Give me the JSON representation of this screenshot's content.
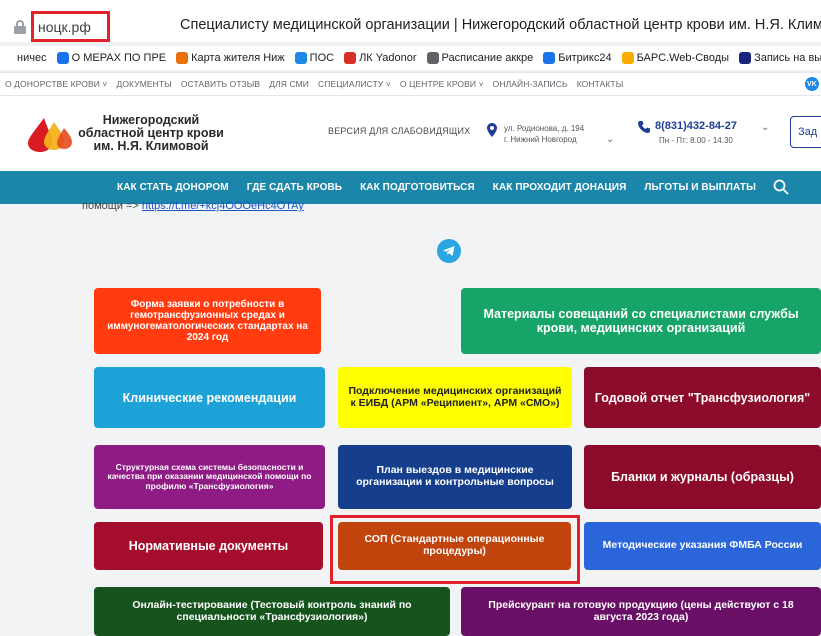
{
  "browser": {
    "url": "ноцк.рф",
    "title": "Специалисту медицинской организации | Нижегородский областной центр крови им. Н.Я. Климовой",
    "bookmarks": [
      {
        "label": "ничес",
        "icon": "blank-icon",
        "color": "#ffffff"
      },
      {
        "label": "О МЕРАХ ПО ПРЕ",
        "icon": "check-circle-icon",
        "color": "#1a73e8"
      },
      {
        "label": "Карта жителя Ниж",
        "icon": "deer-icon",
        "color": "#e8710a"
      },
      {
        "label": "ПОС",
        "icon": "gosuslugi-icon",
        "color": "#1e88e5"
      },
      {
        "label": "ЛК Yadonor",
        "icon": "blood-drop-icon",
        "color": "#d93025"
      },
      {
        "label": "Расписание аккре",
        "icon": "rings-icon",
        "color": "#5f6368"
      },
      {
        "label": "Битрикс24",
        "icon": "bitrix-icon",
        "color": "#1a73e8"
      },
      {
        "label": "БАРС.Web-Своды",
        "icon": "bars-icon",
        "color": "#f9ab00"
      },
      {
        "label": "Запись на выезд",
        "icon": "car-icon",
        "color": "#1a237e"
      }
    ]
  },
  "topnav": {
    "items": [
      "О ДОНОРСТВЕ КРОВИ",
      "ДОКУМЕНТЫ",
      "ОСТАВИТЬ ОТЗЫВ",
      "ДЛЯ СМИ",
      "СПЕЦИАЛИСТУ",
      "О ЦЕНТРЕ КРОВИ",
      "ОНЛАЙН-ЗАПИСЬ",
      "КОНТАКТЫ"
    ],
    "dropdown_flags": [
      true,
      false,
      false,
      false,
      true,
      true,
      false,
      false
    ],
    "vk": "VK"
  },
  "header": {
    "org_line1": "Нижегородский",
    "org_line2": "областной центр крови",
    "org_line3": "им. Н.Я. Климовой",
    "low_vision": "ВЕРСИЯ ДЛЯ СЛАБОВИДЯЩИХ",
    "address_line1": "ул. Родионова, д. 194",
    "address_line2": "г. Нижний Новгород",
    "phone": "8(831)432-84-27",
    "hours": "Пн - Пт: 8.00 - 14.30",
    "cta": "Зад"
  },
  "mainnav": [
    "КАК СТАТЬ ДОНОРОМ",
    "ГДЕ СДАТЬ КРОВЬ",
    "КАК ПОДГОТОВИТЬСЯ",
    "КАК ПРОХОДИТ ДОНАЦИЯ",
    "ЛЬГОТЫ И ВЫПЛАТЫ"
  ],
  "content": {
    "help_prefix": "помощи =>",
    "help_link": "https://t.me/+kcj4OOOeHc4OTAy"
  },
  "tiles": [
    {
      "name": "tile-demand-form",
      "text": "Форма заявки о потребности в гемотрансфузионных средах и иммуногематологических стандартах на 2024 год",
      "bg": "#ff3b0f",
      "fg": "#ffffff",
      "fs": "10px"
    },
    {
      "name": "tile-meeting-materials",
      "text": "Материалы совещаний со специалистами службы крови, медицинских организаций",
      "bg": "#17a468",
      "fg": "#ffffff",
      "fs": "12.5px"
    },
    {
      "name": "tile-clinical-guidelines",
      "text": "Клинические рекомендации",
      "bg": "#1ca2d6",
      "fg": "#ffffff",
      "fs": "12.5px"
    },
    {
      "name": "tile-eibd-connection",
      "text": "Подключение медицинских организаций к ЕИБД (АРМ «Реципиент», АРМ «СМО»)",
      "bg": "#ffff00",
      "fg": "#222222",
      "fs": "10.5px"
    },
    {
      "name": "tile-annual-report",
      "text": "Годовой отчет \"Трансфузиология\"",
      "bg": "#8c0a2a",
      "fg": "#ffffff",
      "fs": "12.5px"
    },
    {
      "name": "tile-safety-scheme",
      "text": "Структурная схема системы безопасности и качества при оказании медицинской помощи по профилю «Трансфузиология»",
      "bg": "#8f1b85",
      "fg": "#ffffff",
      "fs": "8.5px"
    },
    {
      "name": "tile-visit-plan",
      "text": "План выездов в медицинские организации и контрольные вопросы",
      "bg": "#153f8c",
      "fg": "#ffffff",
      "fs": "10.5px"
    },
    {
      "name": "tile-forms-journals",
      "text": "Бланки и журналы (образцы)",
      "bg": "#8c0a2a",
      "fg": "#ffffff",
      "fs": "12.5px"
    },
    {
      "name": "tile-regulatory-docs",
      "text": "Нормативные документы",
      "bg": "#a50d2c",
      "fg": "#ffffff",
      "fs": "12.5px"
    },
    {
      "name": "tile-sop",
      "text": "СОП (Стандартные операционные процедуры)",
      "bg": "#c0440c",
      "fg": "#ffffff",
      "fs": "10.5px"
    },
    {
      "name": "tile-fmba-guidelines",
      "text": "Методические указания ФМБА России",
      "bg": "#2a66d9",
      "fg": "#ffffff",
      "fs": "10.5px"
    },
    {
      "name": "tile-online-test",
      "text": "Онлайн-тестирование (Тестовый контроль знаний по специальности «Трансфузиология»)",
      "bg": "#16541e",
      "fg": "#ffffff",
      "fs": "10.5px"
    },
    {
      "name": "tile-price-list",
      "text": "Прейскурант на готовую продукцию (цены действуют с 18 августа 2023 года)",
      "bg": "#6a0f66",
      "fg": "#ffffff",
      "fs": "10.5px"
    }
  ]
}
